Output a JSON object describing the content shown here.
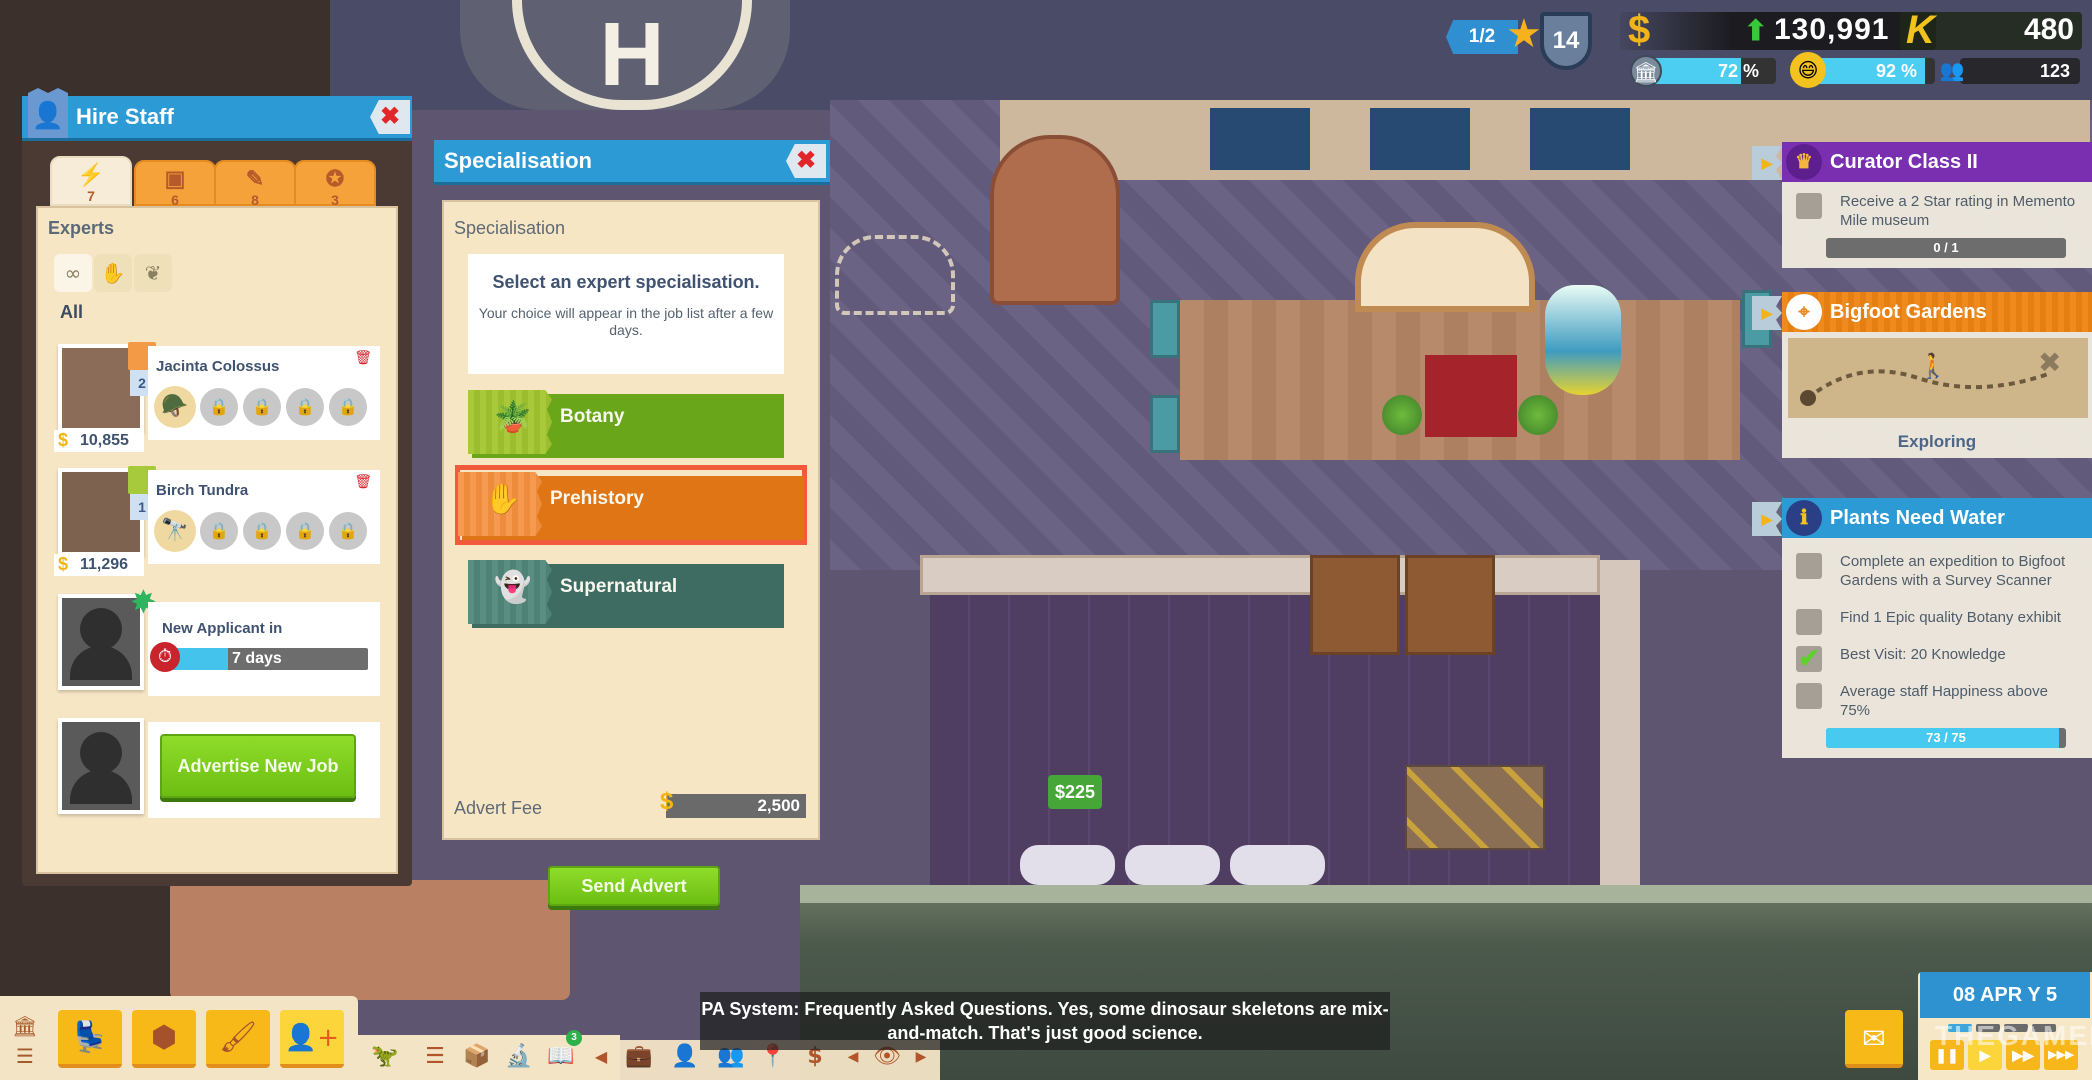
{
  "hud": {
    "star_rating": "1/2",
    "museum_level": "14",
    "money": "130,991",
    "money_trend": "up",
    "knowledge": "480",
    "museum_buzz_percent": 72,
    "museum_buzz_label": "72 %",
    "guest_happiness_percent": 92,
    "guest_happiness_label": "92 %",
    "guest_count": "123",
    "colors": {
      "bar": "#4ccdf2",
      "money": "#f2b417",
      "trend_up": "#38c83a"
    }
  },
  "hire_staff": {
    "title": "Hire Staff",
    "close_icon": "close-x-icon",
    "tabs": [
      {
        "name": "experts",
        "icon": "⚡",
        "count": "7",
        "active": true
      },
      {
        "name": "assistants",
        "icon": "▣",
        "count": "6",
        "active": false
      },
      {
        "name": "janitors",
        "icon": "✎",
        "count": "8",
        "active": false
      },
      {
        "name": "security",
        "icon": "✪",
        "count": "3",
        "active": false
      }
    ],
    "section_title": "Experts",
    "filters": [
      {
        "name": "all",
        "icon": "∞",
        "active": true
      },
      {
        "name": "prehistory",
        "icon": "✋",
        "active": false
      },
      {
        "name": "botany",
        "icon": "❦",
        "active": false
      }
    ],
    "filter_label": "All",
    "candidates": [
      {
        "name": "Jacinta Colossus",
        "specialisation": "Prehistory",
        "level": "2",
        "salary": "10,855",
        "main_skill_icon": "🪖",
        "locked_skills": 4
      },
      {
        "name": "Birch Tundra",
        "specialisation": "Botany",
        "level": "1",
        "salary": "11,296",
        "main_skill_icon": "🔭",
        "locked_skills": 4
      }
    ],
    "new_applicant": {
      "label": "New Applicant in",
      "time_left": "7 days",
      "progress_percent": 30
    },
    "advertise_button": "Advertise New Job"
  },
  "specialisation": {
    "title": "Specialisation",
    "heading": "Specialisation",
    "prompt_title": "Select an expert specialisation.",
    "prompt_text": "Your choice will appear in the job list after a few days.",
    "options": [
      {
        "label": "Botany",
        "icon": "🪴",
        "color": "#6aa61a",
        "stripe": "#a8c93a",
        "selected": false
      },
      {
        "label": "Prehistory",
        "icon": "✋",
        "color": "#e07516",
        "stripe": "#f59a4e",
        "selected": true
      },
      {
        "label": "Supernatural",
        "icon": "👻",
        "color": "#3e6b62",
        "stripe": "#5b8e82",
        "selected": false
      }
    ],
    "fee_label": "Advert Fee",
    "fee_value": "2,500",
    "send_button": "Send Advert"
  },
  "objectives": [
    {
      "title": "Curator Class II",
      "color": "#7a2fb0",
      "icon": "♛",
      "tasks": [
        {
          "text": "Receive a 2 Star rating in Memento Mile museum",
          "done": false,
          "progress": "0 / 1",
          "progress_percent": 0
        }
      ]
    },
    {
      "title": "Bigfoot Gardens",
      "color": "#ee8a1e",
      "icon": "⌖",
      "status": "Exploring"
    },
    {
      "title": "Plants Need Water",
      "color": "#2c9ad4",
      "icon": "ℹ",
      "tasks": [
        {
          "text": "Complete an expedition to Bigfoot Gardens with a Survey Scanner",
          "done": false
        },
        {
          "text": "Find 1 Epic quality Botany exhibit",
          "done": false
        },
        {
          "text": "Best Visit: 20 Knowledge",
          "done": true
        },
        {
          "text": "Average staff Happiness above 75%",
          "done": false,
          "progress": "73 / 75",
          "progress_percent": 97
        }
      ]
    }
  ],
  "world": {
    "price_popup": "225",
    "helipad_letter": "H"
  },
  "toolbar": {
    "side_icons": [
      "museum-icon",
      "menu-icon"
    ],
    "big_buttons": [
      {
        "name": "furniture",
        "icon": "💺",
        "active": false
      },
      {
        "name": "rooms",
        "icon": "⬢",
        "active": false
      },
      {
        "name": "decorate",
        "icon": "🖌",
        "active": false
      },
      {
        "name": "hire-staff",
        "icon": "👤+",
        "active": true
      }
    ],
    "small_buttons": [
      {
        "name": "exhibits",
        "icon": "🦖"
      },
      {
        "name": "list",
        "icon": "☰"
      },
      {
        "name": "storage",
        "icon": "📦"
      },
      {
        "name": "research",
        "icon": "🔬"
      },
      {
        "name": "logbook",
        "icon": "📖",
        "badge": "3"
      },
      {
        "name": "collapse",
        "icon": "◀"
      },
      {
        "name": "expeditions",
        "icon": "💼"
      },
      {
        "name": "staff-list",
        "icon": "👤"
      },
      {
        "name": "guests",
        "icon": "👥"
      },
      {
        "name": "map",
        "icon": "📍"
      },
      {
        "name": "finances",
        "icon": "$"
      },
      {
        "name": "prev-view",
        "icon": "◀"
      },
      {
        "name": "view",
        "icon": "👁"
      },
      {
        "name": "next-view",
        "icon": "▶"
      }
    ]
  },
  "pa_system": "PA System: Frequently Asked Questions. Yes, some dinosaur skeletons are mix-and-match. That's just good science.",
  "time": {
    "date": "08 APR Y 5",
    "speed_level": 1,
    "speed_buttons": [
      "❚❚",
      "▶",
      "▶▶",
      "▶▶▶"
    ]
  },
  "watermark": "THEGAMER"
}
